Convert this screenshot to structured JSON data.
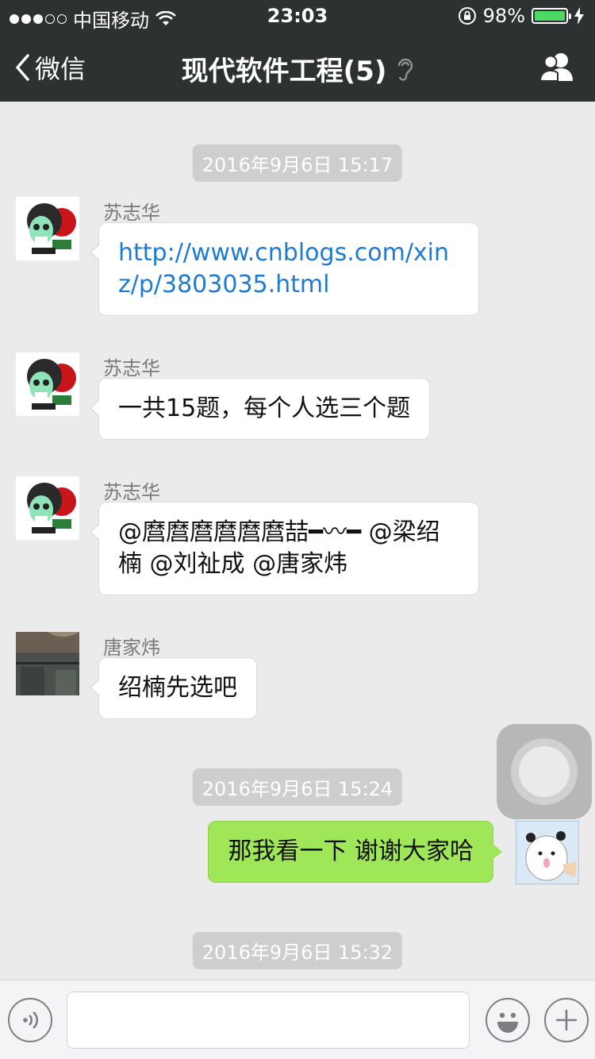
{
  "status": {
    "carrier": "中国移动",
    "time": "23:03",
    "battery": "98%",
    "battery_level": 0.98,
    "signal_bars": 3,
    "signal_total": 5
  },
  "nav": {
    "back_label": "微信",
    "title": "现代软件工程(5)"
  },
  "timestamps": [
    "2016年9月6日 15:17",
    "2016年9月6日 15:24",
    "2016年9月6日 15:32"
  ],
  "messages": [
    {
      "sender": "苏志华",
      "text": "http://www.cnblogs.com/xinz/p/3803035.html"
    },
    {
      "sender": "苏志华",
      "text": "一共15题，每个人选三个题"
    },
    {
      "sender": "苏志华",
      "text": "@麿麿麿麿麿麿喆━〰━ @梁绍楠 @刘祉成 @唐家炜"
    },
    {
      "sender": "唐家炜",
      "text": "绍楠先选吧"
    }
  ],
  "my_message": {
    "text": "那我看一下 谢谢大家哈"
  },
  "input": {
    "value": ""
  },
  "colors": {
    "nav_bg": "#2e3132",
    "chat_bg": "#ebebeb",
    "my_bubble": "#9fe658",
    "link": "#1e7bd4"
  }
}
